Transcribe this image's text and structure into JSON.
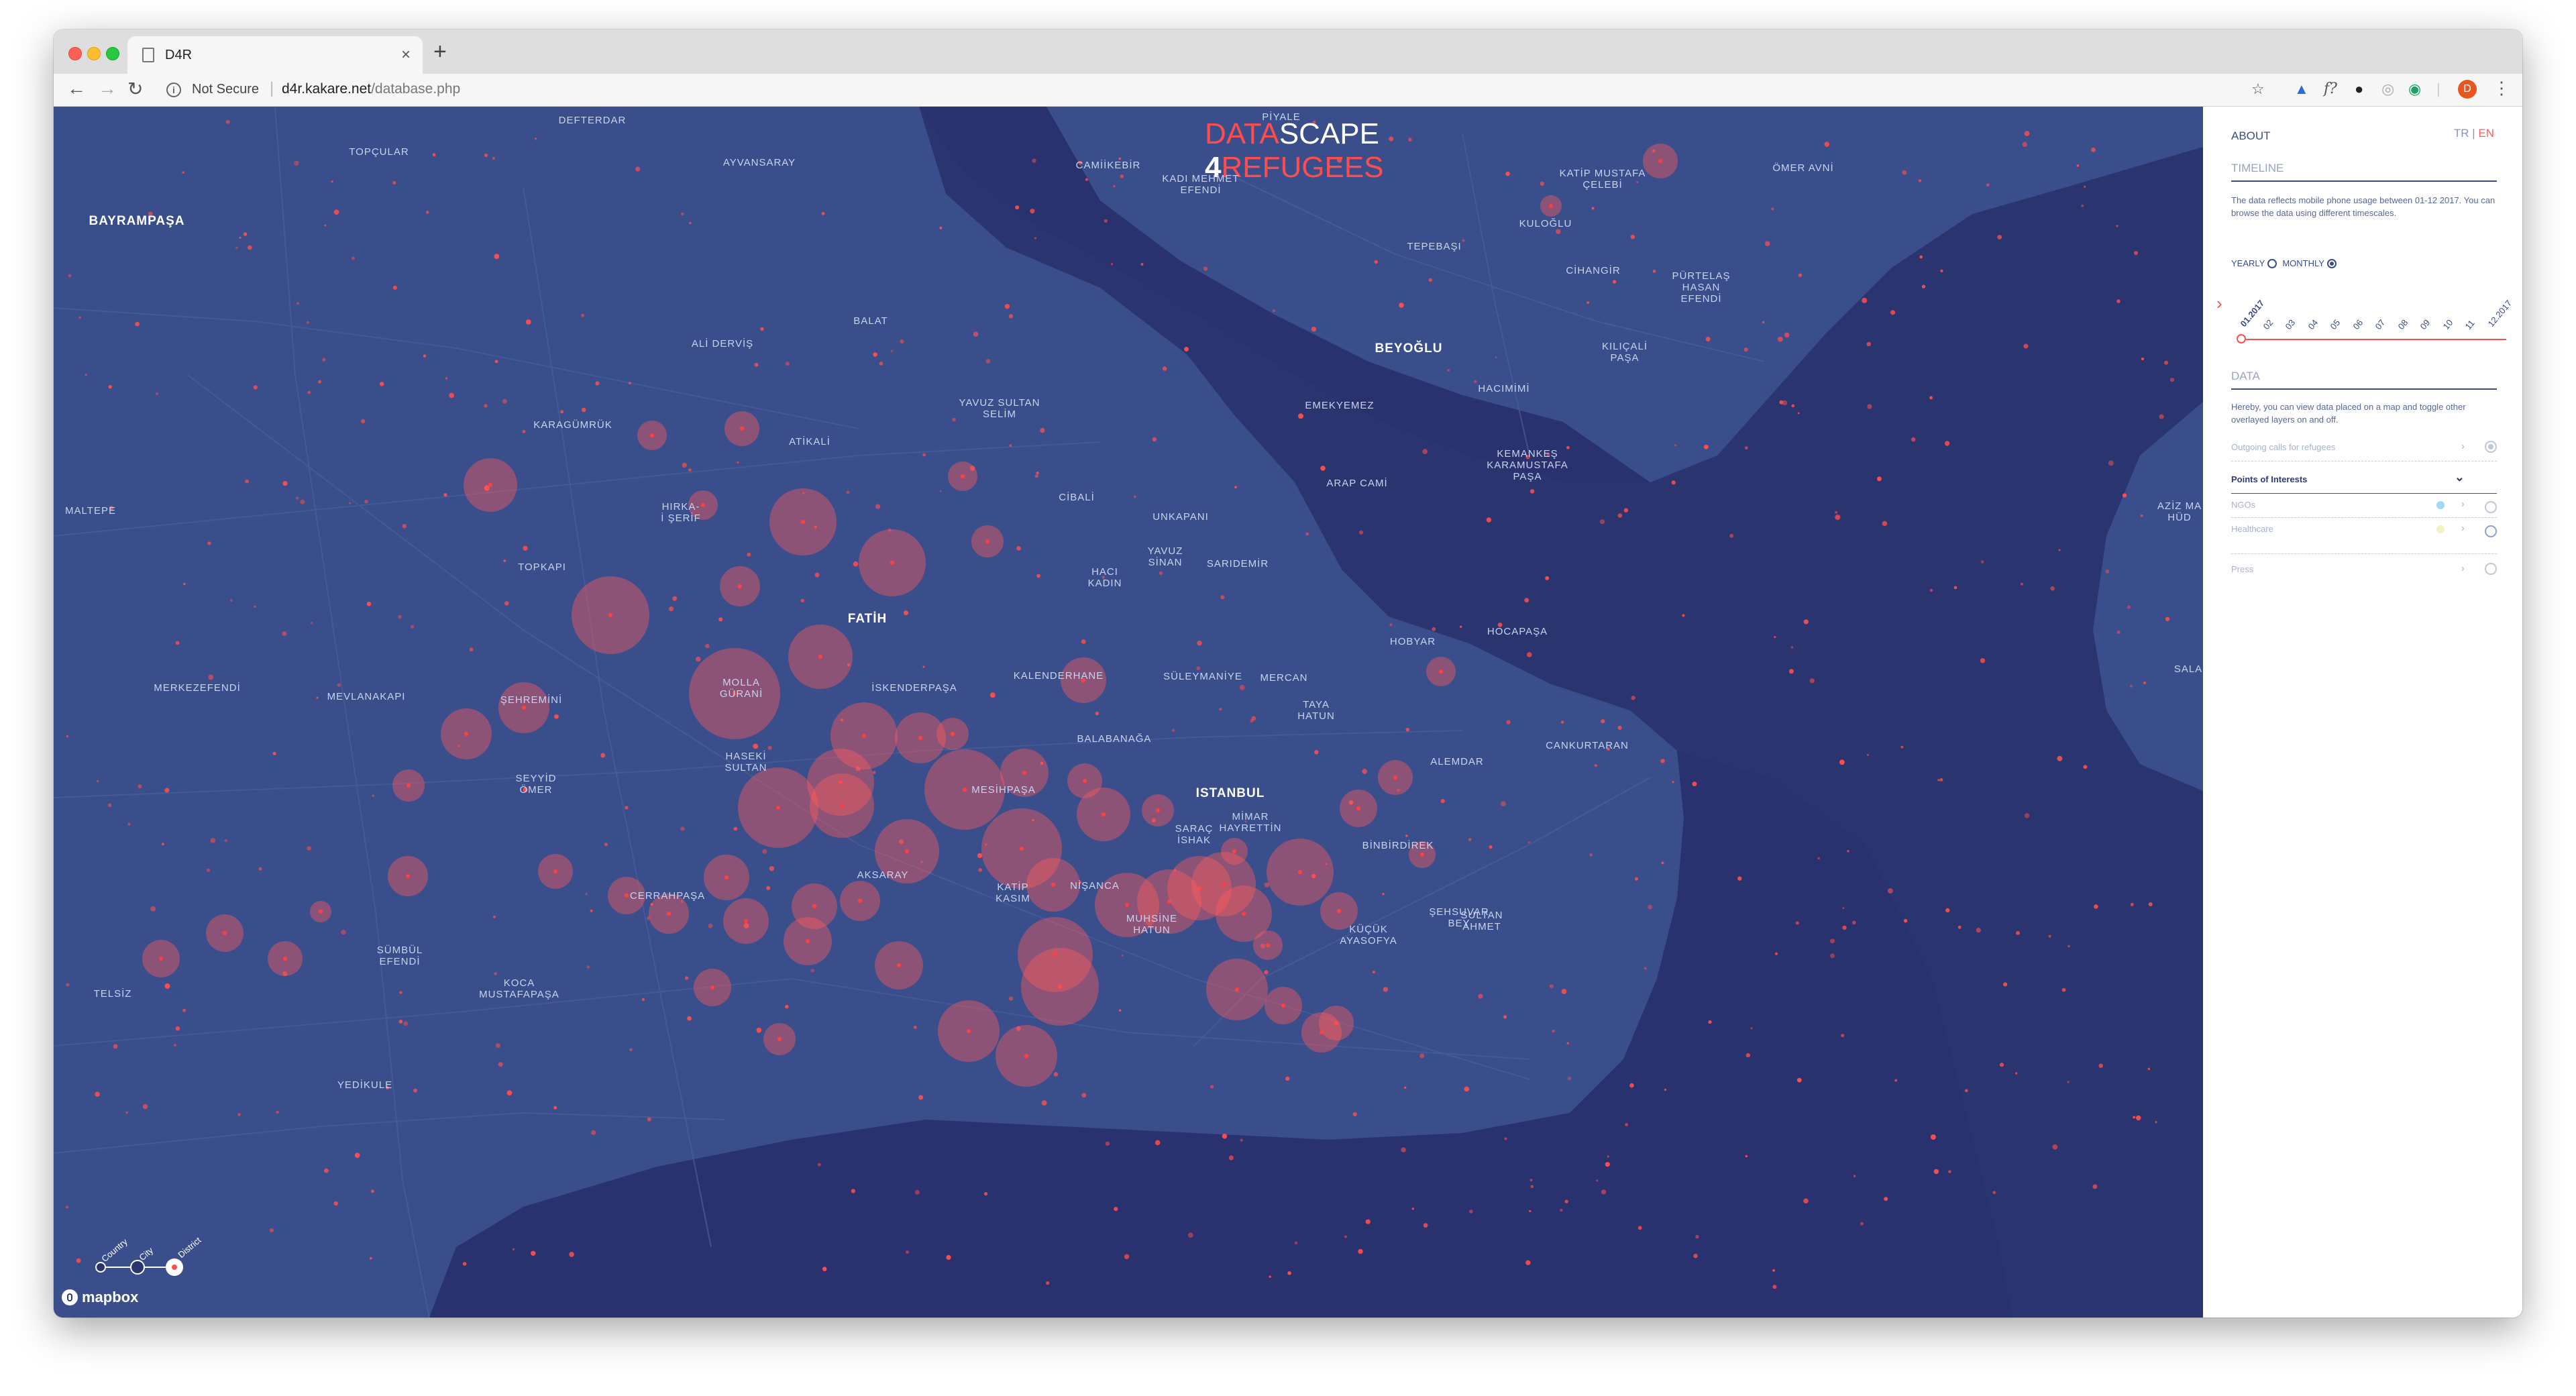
{
  "browser": {
    "tab_title": "D4R",
    "tab_close": "×",
    "new_tab": "+",
    "security_label": "Not Secure",
    "url_host": "d4r.kakare.net",
    "url_path": "/database.php",
    "avatar_letter": "D"
  },
  "logo": {
    "line1_red": "DATA",
    "line1_white": "SCAPE",
    "line2_four": "4",
    "line2_red": "REFUGEES"
  },
  "colors": {
    "map_bg": "#2a3570",
    "land": "#3a4e8c",
    "water": "#29326e",
    "bubble": "#ff5a5a",
    "panel_text": "#3b4a8a"
  },
  "places": [
    {
      "label": "DEFTERDAR"
    },
    {
      "label": "TOPÇULAR"
    },
    {
      "label": "AYVANSARAY"
    },
    {
      "label": "PİYALE"
    },
    {
      "label": "CAMİİKEBİR"
    },
    {
      "label": "KADI MEHMET\nEFENDİ"
    },
    {
      "label": "KATİP MUSTAFA\nÇELEBİ"
    },
    {
      "label": "ÖMER AVNİ"
    },
    {
      "label": "KULOĞLU"
    },
    {
      "label": "TEPEBAŞI"
    },
    {
      "label": "CİHANGİR"
    },
    {
      "label": "PÜRTELAŞ\nHASAN\nEFENDİ"
    },
    {
      "label": "BALAT"
    },
    {
      "label": "ALİ DERVİŞ"
    },
    {
      "label": "KILIÇALİ\nPAŞA"
    },
    {
      "label": "HACIMİMİ"
    },
    {
      "label": "YAVUZ SULTAN\nSELİM"
    },
    {
      "label": "KARAGÜMRÜK"
    },
    {
      "label": "ATİKALİ"
    },
    {
      "label": "EMEKYEMEZ"
    },
    {
      "label": "KEMANKEŞ\nKARAMUSTAFA\nPAŞA"
    },
    {
      "label": "ARAP CAMİ"
    },
    {
      "label": "MALTEPE"
    },
    {
      "label": "HIRKA-\nİ ŞERİF"
    },
    {
      "label": "CİBALİ"
    },
    {
      "label": "UNKAPANI"
    },
    {
      "label": "YAVUZ\nSİNAN"
    },
    {
      "label": "TOPKAPI"
    },
    {
      "label": "SARIDEMİR"
    },
    {
      "label": "HACI\nKADIN"
    },
    {
      "label": "HOBYAR"
    },
    {
      "label": "HOCAPAŞA"
    },
    {
      "label": "KALENDERHANE"
    },
    {
      "label": "SÜLEYMANİYE"
    },
    {
      "label": "MERCAN"
    },
    {
      "label": "MOLLA\nGÜRANİ"
    },
    {
      "label": "İSKENDERPAŞA"
    },
    {
      "label": "MERKEZEFENDİ"
    },
    {
      "label": "MEVLANAKAPI"
    },
    {
      "label": "ŞEHREMİNİ"
    },
    {
      "label": "TAYA\nHATUN"
    },
    {
      "label": "BALABANAĞA"
    },
    {
      "label": "CANKURTARAN"
    },
    {
      "label": "ALEMDAR"
    },
    {
      "label": "HASEKİ\nSULTAN"
    },
    {
      "label": "SEYYİD\nÖMER"
    },
    {
      "label": "MESİHPAŞA"
    },
    {
      "label": "MİMAR\nHAYRETTİN"
    },
    {
      "label": "SARAÇ\nİSHAK"
    },
    {
      "label": "BİNBİRDİREK"
    },
    {
      "label": "AKSARAY"
    },
    {
      "label": "CERRAHPAŞA"
    },
    {
      "label": "KATİP\nKASIM"
    },
    {
      "label": "NİŞANCA"
    },
    {
      "label": "ŞEHSUVAR\nBEY"
    },
    {
      "label": "MUHSİNE\nHATUN"
    },
    {
      "label": "SULTAN\nAHMET"
    },
    {
      "label": "KÜÇÜK\nAYASOFYA"
    },
    {
      "label": "SÜMBÜL\nEFENDİ"
    },
    {
      "label": "KOCA\nMUSTAFAPAŞA"
    },
    {
      "label": "TELSİZ"
    },
    {
      "label": "YEDİKULE"
    },
    {
      "label": "AZİZ MA\nHÜD"
    },
    {
      "label": "SALA"
    }
  ],
  "districts": [
    {
      "label": "BAYRAMPAŞA"
    },
    {
      "label": "BEYOĞLU"
    },
    {
      "label": "FATİH"
    },
    {
      "label": "ISTANBUL"
    }
  ],
  "scale_switch": {
    "options": [
      "Country",
      "City",
      "District"
    ],
    "selected": "District"
  },
  "attribution": "mapbox",
  "panel": {
    "about": "ABOUT",
    "lang_tr": "TR",
    "lang_sep": "|",
    "lang_en": "EN",
    "timeline_heading": "TIMELINE",
    "timeline_text": "The data reflects mobile phone usage between 01-12 2017. You can browse the data using different timescales.",
    "yearly_label": "YEARLY",
    "monthly_label": "MONTHLY",
    "timeline_mode": "MONTHLY",
    "months": [
      "01.2017",
      "02",
      "03",
      "04",
      "05",
      "06",
      "07",
      "08",
      "09",
      "10",
      "11",
      "12.2017"
    ],
    "selected_month_index": 0,
    "data_heading": "DATA",
    "data_text": "Hereby, you can view data placed on a map and toggle other overlayed layers on and off.",
    "layers": [
      {
        "label": "Outgoing calls for refugees",
        "enabled": true
      },
      {
        "label": "Points of Interests",
        "enabled": false
      },
      {
        "label": "NGOs",
        "enabled": false,
        "swatch": "#9fd8f5"
      },
      {
        "label": "Healthcare",
        "enabled": false,
        "swatch": "#f2f2c2"
      },
      {
        "label": "Press",
        "enabled": false
      }
    ],
    "poi_chevron": "⌄"
  }
}
